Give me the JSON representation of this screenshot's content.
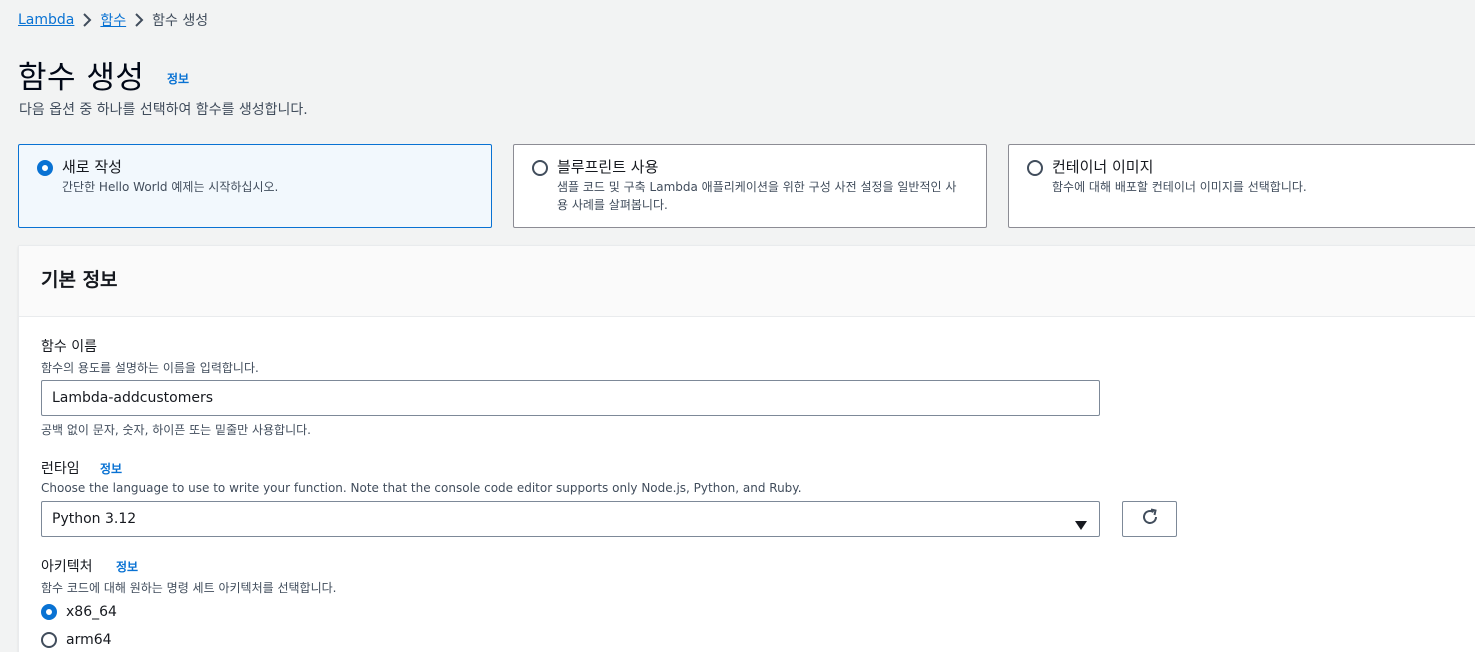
{
  "breadcrumb": {
    "items": [
      "Lambda",
      "함수"
    ],
    "current": "함수 생성"
  },
  "header": {
    "title": "함수 생성",
    "info": "정보",
    "description": "다음 옵션 중 하나를 선택하여 함수를 생성합니다."
  },
  "options": [
    {
      "title": "새로 작성",
      "desc": "간단한 Hello World 예제는 시작하십시오.",
      "selected": true
    },
    {
      "title": "블루프린트 사용",
      "desc": "샘플 코드 및 구축 Lambda 애플리케이션을 위한 구성 사전 설정을 일반적인 사용 사례를 살펴봅니다.",
      "selected": false
    },
    {
      "title": "컨테이너 이미지",
      "desc": "함수에 대해 배포할 컨테이너 이미지를 선택합니다.",
      "selected": false
    }
  ],
  "basic_info": {
    "title": "기본 정보",
    "function_name": {
      "label": "함수 이름",
      "description": "함수의 용도를 설명하는 이름을 입력합니다.",
      "value": "Lambda-addcustomers",
      "constraint": "공백 없이 문자, 숫자, 하이픈 또는 밑줄만 사용합니다."
    },
    "runtime": {
      "label": "런타임",
      "info": "정보",
      "description": "Choose the language to use to write your function. Note that the console code editor supports only Node.js, Python, and Ruby.",
      "value": "Python 3.12"
    },
    "architecture": {
      "label": "아키텍처",
      "info": "정보",
      "description": "함수 코드에 대해 원하는 명령 세트 아키텍처를 선택합니다.",
      "options": [
        {
          "label": "x86_64",
          "selected": true
        },
        {
          "label": "arm64",
          "selected": false
        }
      ]
    }
  },
  "colors": {
    "link": "#0972d3",
    "selected_bg": "#f2f8fd",
    "page_bg": "#f2f3f3"
  },
  "icons": {
    "breadcrumb_separator": "chevron-right-icon",
    "select_caret": "caret-down-icon",
    "refresh": "refresh-icon"
  }
}
